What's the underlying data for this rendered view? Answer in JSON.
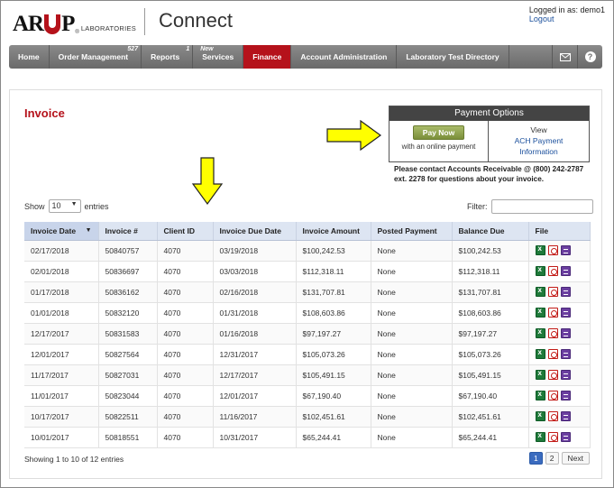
{
  "header": {
    "brand_text_pre": "AR",
    "brand_text_post": "P",
    "brand_sub": "LABORATORIES",
    "app_name": "Connect",
    "logged_in": "Logged in as: demo1",
    "logout": "Logout"
  },
  "nav": {
    "items": [
      {
        "label": "Home",
        "badge": ""
      },
      {
        "label": "Order Management",
        "badge": "527"
      },
      {
        "label": "Reports",
        "badge": "1"
      },
      {
        "label": "Services",
        "badge": "New"
      },
      {
        "label": "Finance",
        "badge": ""
      },
      {
        "label": "Account Administration",
        "badge": ""
      },
      {
        "label": "Laboratory Test Directory",
        "badge": ""
      }
    ],
    "active": "Finance",
    "icons": [
      "mail-icon",
      "help-icon"
    ],
    "help_glyph": "?"
  },
  "page": {
    "title": "Invoice"
  },
  "payment": {
    "header": "Payment Options",
    "pay_button": "Pay Now",
    "pay_sub": "with an online payment",
    "view_label": "View",
    "ach_link_line1": "ACH Payment",
    "ach_link_line2": "Information",
    "note": "Please contact Accounts Receivable @ (800) 242-2787 ext. 2278 for questions about your invoice."
  },
  "table_controls": {
    "show_label": "Show",
    "show_value": "10",
    "entries_label": "entries",
    "filter_label": "Filter:"
  },
  "table": {
    "columns": [
      "Invoice Date",
      "Invoice #",
      "Client ID",
      "Invoice Due Date",
      "Invoice Amount",
      "Posted Payment",
      "Balance Due",
      "File"
    ],
    "rows": [
      {
        "date": "02/17/2018",
        "num": "50840757",
        "client": "4070",
        "due": "03/19/2018",
        "amount": "$100,242.53",
        "posted": "None",
        "balance": "$100,242.53"
      },
      {
        "date": "02/01/2018",
        "num": "50836697",
        "client": "4070",
        "due": "03/03/2018",
        "amount": "$112,318.11",
        "posted": "None",
        "balance": "$112,318.11"
      },
      {
        "date": "01/17/2018",
        "num": "50836162",
        "client": "4070",
        "due": "02/16/2018",
        "amount": "$131,707.81",
        "posted": "None",
        "balance": "$131,707.81"
      },
      {
        "date": "01/01/2018",
        "num": "50832120",
        "client": "4070",
        "due": "01/31/2018",
        "amount": "$108,603.86",
        "posted": "None",
        "balance": "$108,603.86"
      },
      {
        "date": "12/17/2017",
        "num": "50831583",
        "client": "4070",
        "due": "01/16/2018",
        "amount": "$97,197.27",
        "posted": "None",
        "balance": "$97,197.27"
      },
      {
        "date": "12/01/2017",
        "num": "50827564",
        "client": "4070",
        "due": "12/31/2017",
        "amount": "$105,073.26",
        "posted": "None",
        "balance": "$105,073.26"
      },
      {
        "date": "11/17/2017",
        "num": "50827031",
        "client": "4070",
        "due": "12/17/2017",
        "amount": "$105,491.15",
        "posted": "None",
        "balance": "$105,491.15"
      },
      {
        "date": "11/01/2017",
        "num": "50823044",
        "client": "4070",
        "due": "12/01/2017",
        "amount": "$67,190.40",
        "posted": "None",
        "balance": "$67,190.40"
      },
      {
        "date": "10/17/2017",
        "num": "50822511",
        "client": "4070",
        "due": "11/16/2017",
        "amount": "$102,451.61",
        "posted": "None",
        "balance": "$102,451.61"
      },
      {
        "date": "10/01/2017",
        "num": "50818551",
        "client": "4070",
        "due": "10/31/2017",
        "amount": "$65,244.41",
        "posted": "None",
        "balance": "$65,244.41"
      }
    ],
    "file_icons": [
      "excel-icon",
      "pdf-icon",
      "document-icon"
    ]
  },
  "footer": {
    "showing": "Showing 1 to 10 of 12 entries",
    "pages": [
      "1",
      "2"
    ],
    "current_page": "1",
    "next": "Next"
  },
  "colors": {
    "brand_red": "#b5121b",
    "nav_gray": "#777777",
    "header_blue": "#dde5f2",
    "link_blue": "#1a4f9c",
    "arrow_yellow": "#ffff00"
  }
}
